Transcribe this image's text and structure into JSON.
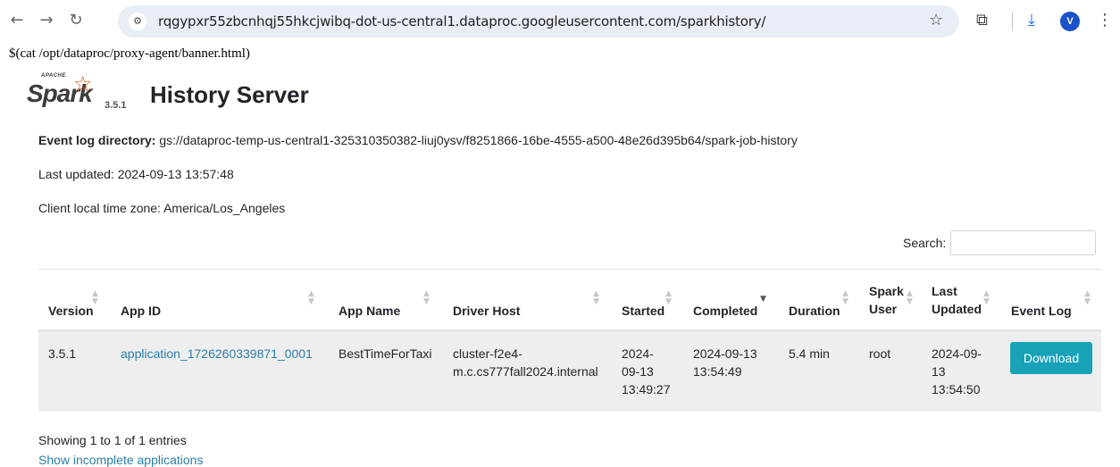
{
  "browser": {
    "url": "rqgypxr55zbcnhqj55hkcjwibq-dot-us-central1.dataproc.googleusercontent.com/sparkhistory/",
    "avatar_letter": "V"
  },
  "page": {
    "banner": "$(cat /opt/dataproc/proxy-agent/banner.html)",
    "logo_apache": "APACHE",
    "logo_spark": "Spark",
    "spark_version": "3.5.1",
    "title": "History Server",
    "event_log_label": "Event log directory:",
    "event_log_value": "gs://dataproc-temp-us-central1-325310350382-liuj0ysv/f8251866-16be-4555-a500-48e26d395b64/spark-job-history",
    "last_updated": "Last updated: 2024-09-13 13:57:48",
    "timezone": "Client local time zone: America/Los_Angeles",
    "search_label": "Search:",
    "search_value": ""
  },
  "table": {
    "headers": {
      "version": "Version",
      "app_id": "App ID",
      "app_name": "App Name",
      "driver_host": "Driver Host",
      "started": "Started",
      "completed": "Completed",
      "duration": "Duration",
      "spark_user_1": "Spark",
      "spark_user_2": "User",
      "last_updated_1": "Last",
      "last_updated_2": "Updated",
      "event_log": "Event Log"
    },
    "rows": [
      {
        "version": "3.5.1",
        "app_id": "application_1726260339871_0001",
        "app_name": "BestTimeForTaxi",
        "driver_host_1": "cluster-f2e4-",
        "driver_host_2": "m.c.cs777fall2024.internal",
        "started_1": "2024-",
        "started_2": "09-13",
        "started_3": "13:49:27",
        "completed_1": "2024-09-13",
        "completed_2": "13:54:49",
        "duration": "5.4 min",
        "spark_user": "root",
        "last_updated_1": "2024-09-",
        "last_updated_2": "13",
        "last_updated_3": "13:54:50",
        "event_log": "Download"
      }
    ]
  },
  "footer": {
    "showing": "Showing 1 to 1 of 1 entries",
    "show_incomplete": "Show incomplete applications"
  }
}
